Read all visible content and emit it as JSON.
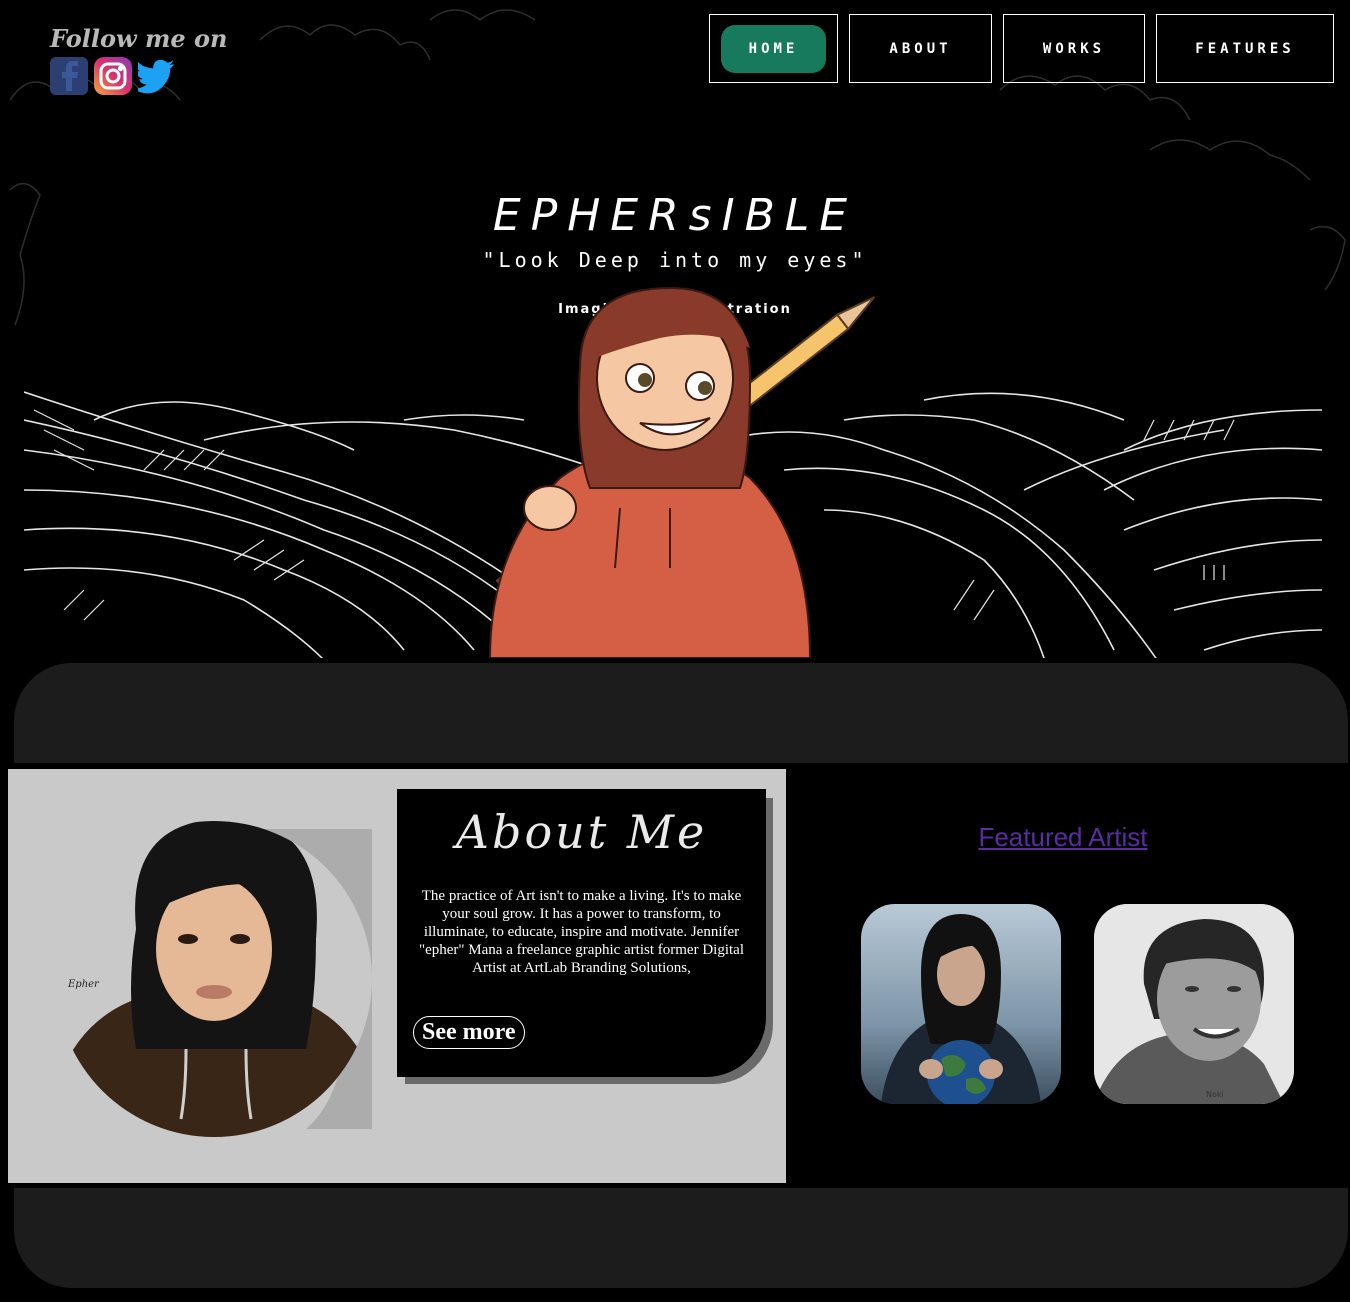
{
  "header": {
    "follow_label": "Follow me on",
    "social": [
      {
        "icon": "facebook-icon",
        "color": "#2b3f73"
      },
      {
        "icon": "instagram-icon",
        "color": "#d8336d"
      },
      {
        "icon": "twitter-icon",
        "color": "#1da1f2"
      }
    ]
  },
  "nav": {
    "home": "HOME",
    "about": "ABOUT",
    "works": "WORKS",
    "features": "FEATURES",
    "active": "HOME",
    "active_color": "#187a5c"
  },
  "hero": {
    "brand": "EPHERsIBLE",
    "quote": "\"Look Deep into my eyes\"",
    "tagline": "Imaginative | Illustration"
  },
  "about": {
    "title": "About Me",
    "body": "The practice of Art isn't to make a living. It's to make your soul grow. It has a power to transform, to illuminate, to educate, inspire and motivate. Jennifer \"epher\" Mana a freelance graphic artist former Digital Artist at ArtLab Branding Solutions,",
    "see_more": "See more",
    "signature": "Epher"
  },
  "featured": {
    "title": "Featured Artist",
    "link_color": "#5a2ca0",
    "watermark": "Noki"
  },
  "colors": {
    "background": "#000000",
    "band": "#1c1c1c",
    "about_panel": "#c9c9c9"
  }
}
